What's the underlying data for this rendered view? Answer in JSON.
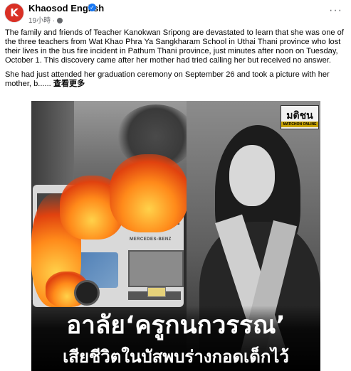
{
  "header": {
    "page_name": "Khaosod English",
    "avatar_letter": "K",
    "timestamp": "19小時",
    "timestamp_separator": "·",
    "more_icon": "more-horizontal-icon",
    "brand_color": "#d93025",
    "verified_color": "#1877f2"
  },
  "post": {
    "paragraph_1": "The family and friends of Teacher Kanokwan Sripong are devastated to learn that she was one of the three teachers from Wat Khao Phra Ya Sangkharam School in Uthai Thani province who lost their lives in the bus fire incident in Pathum Thani province, just minutes after noon on Tuesday, October 1. This discovery came after her mother had tried calling her but received no answer.",
    "paragraph_2": "She had just attended her graduation ceremony on September 26 and took a picture with her mother, b......",
    "see_more": "查看更多"
  },
  "photo": {
    "logo_main": "มติชน",
    "logo_sub": "MATICHON ONLINE",
    "bus_brand": "MERCEDES-BENZ",
    "headline_1": "อาลัย‘ครูกนกวรรณ’",
    "headline_2": "เสียชีวิตในบัสพบร่างกอดเด็กไว้"
  }
}
